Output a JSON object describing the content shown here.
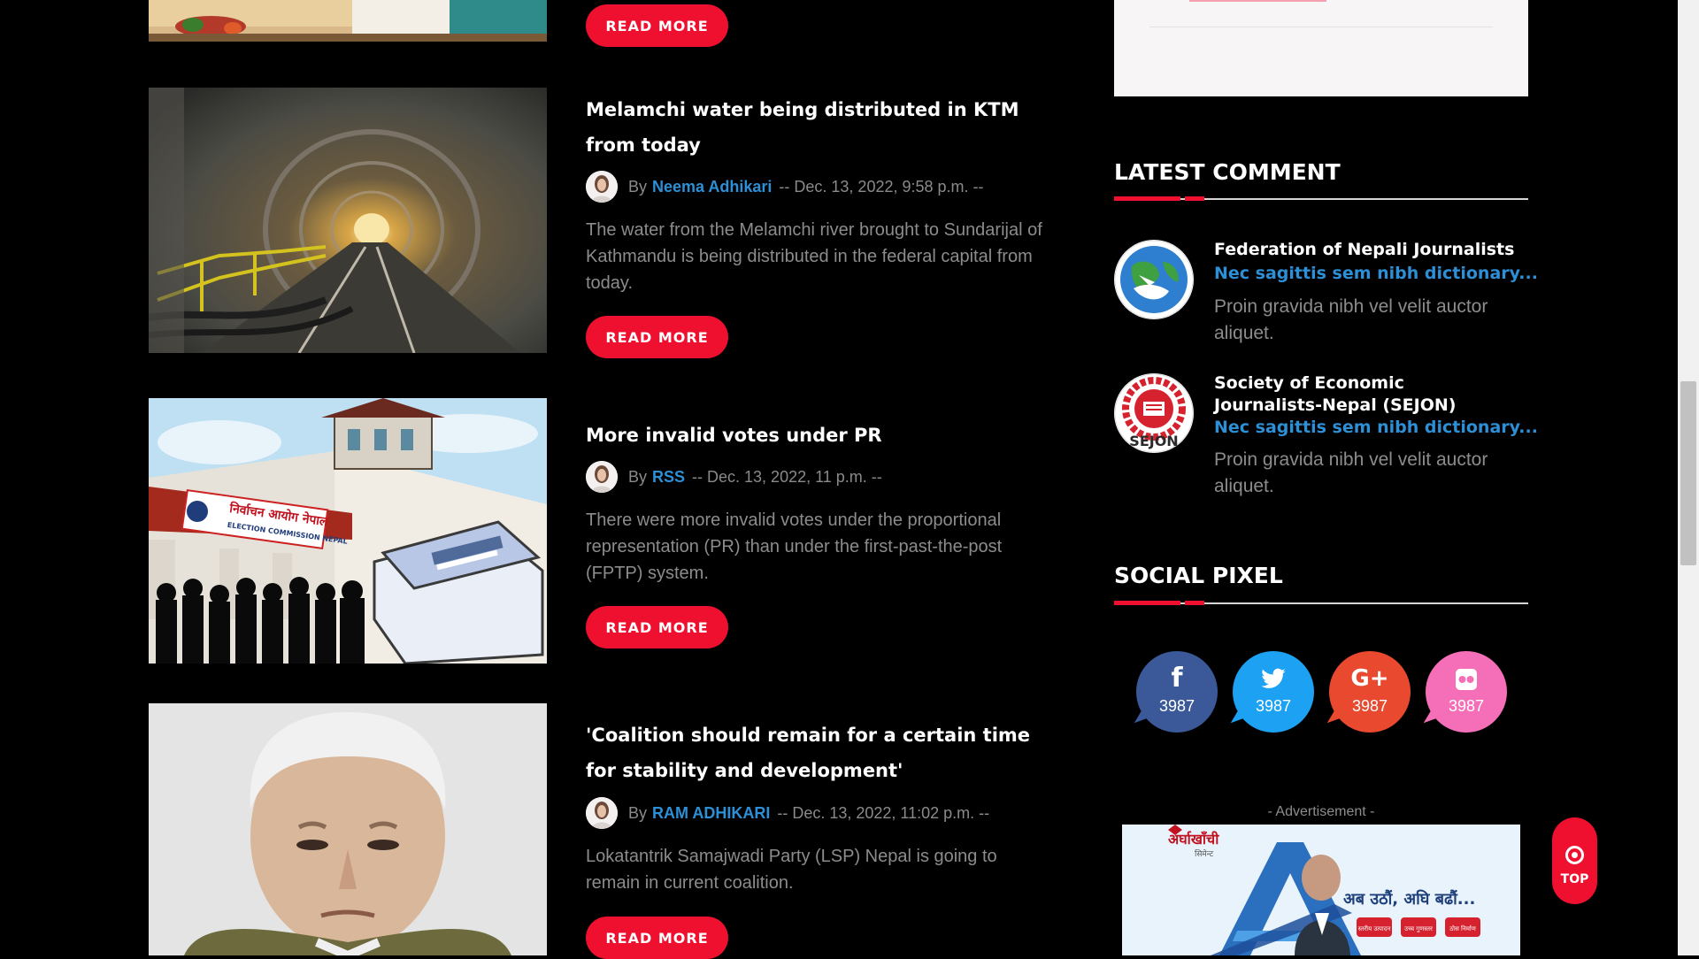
{
  "articles": [
    {
      "title": "Melamchi water being distributed in KTM from today",
      "by": "By",
      "author": "Neema Adhikari",
      "date": "-- Dec. 13, 2022, 9:58 p.m. --",
      "excerpt": "The water from the Melamchi river brought to Sundarijal of Kathmandu is being distributed in the federal capital from today.",
      "read_more": "READ MORE"
    },
    {
      "title": "More invalid votes under PR",
      "by": "By",
      "author": "RSS",
      "date": "-- Dec. 13, 2022, 11 p.m. --",
      "excerpt": "There were more invalid votes under the proportional representation (PR) than under the first-past-the-post (FPTP) system.",
      "read_more": "READ MORE"
    },
    {
      "title": "'Coalition should remain for a certain time for stability and development'",
      "by": "By",
      "author": "RAM ADHIKARI",
      "date": "-- Dec. 13, 2022, 11:02 p.m. --",
      "excerpt": "Lokatantrik Samajwadi Party (LSP) Nepal is going to remain in current coalition.",
      "read_more": "READ MORE"
    }
  ],
  "top_read_more": "READ MORE",
  "election_sign": {
    "nepali": "निर्वाचन आयोग नेपाल",
    "english": "ELECTION COMMISSION NEPAL"
  },
  "latest_comment": {
    "heading": "LATEST COMMENT",
    "items": [
      {
        "name": "Federation of Nepali Journalists",
        "link": "Nec sagittis sem nibh dictionary...",
        "text": "Proin gravida nibh vel velit auctor aliquet."
      },
      {
        "name": "Society of Economic Journalists-Nepal (SEJON)",
        "link": "Nec sagittis sem nibh dictionary...",
        "text": "Proin gravida nibh vel velit auctor aliquet.",
        "logo_text": "SEJON"
      }
    ]
  },
  "social_pixel": {
    "heading": "SOCIAL PIXEL",
    "items": [
      {
        "network": "facebook",
        "glyph": "f",
        "count": "3987",
        "color": "#3b5998"
      },
      {
        "network": "twitter",
        "glyph": "🐦",
        "count": "3987",
        "color": "#1da1f2"
      },
      {
        "network": "google-plus",
        "glyph": "G+",
        "count": "3987",
        "color": "#e8492f"
      },
      {
        "network": "flickr",
        "glyph": "●●",
        "count": "3987",
        "color": "#f46fb7"
      }
    ]
  },
  "advertisement": {
    "label": "- Advertisement -",
    "brand": "अर्घाखाँची",
    "sub": "सिमेन्ट",
    "slogan": "अब उठौं, अघि बढौं...",
    "badges": [
      "स्तरीय उत्पादन",
      "उच्च गुणस्तर",
      "ठोस निर्माण"
    ]
  },
  "top_button": {
    "label": "TOP"
  },
  "colors": {
    "accent": "#ef1030",
    "link": "#2d8fd6",
    "muted": "#8c8c8c"
  }
}
